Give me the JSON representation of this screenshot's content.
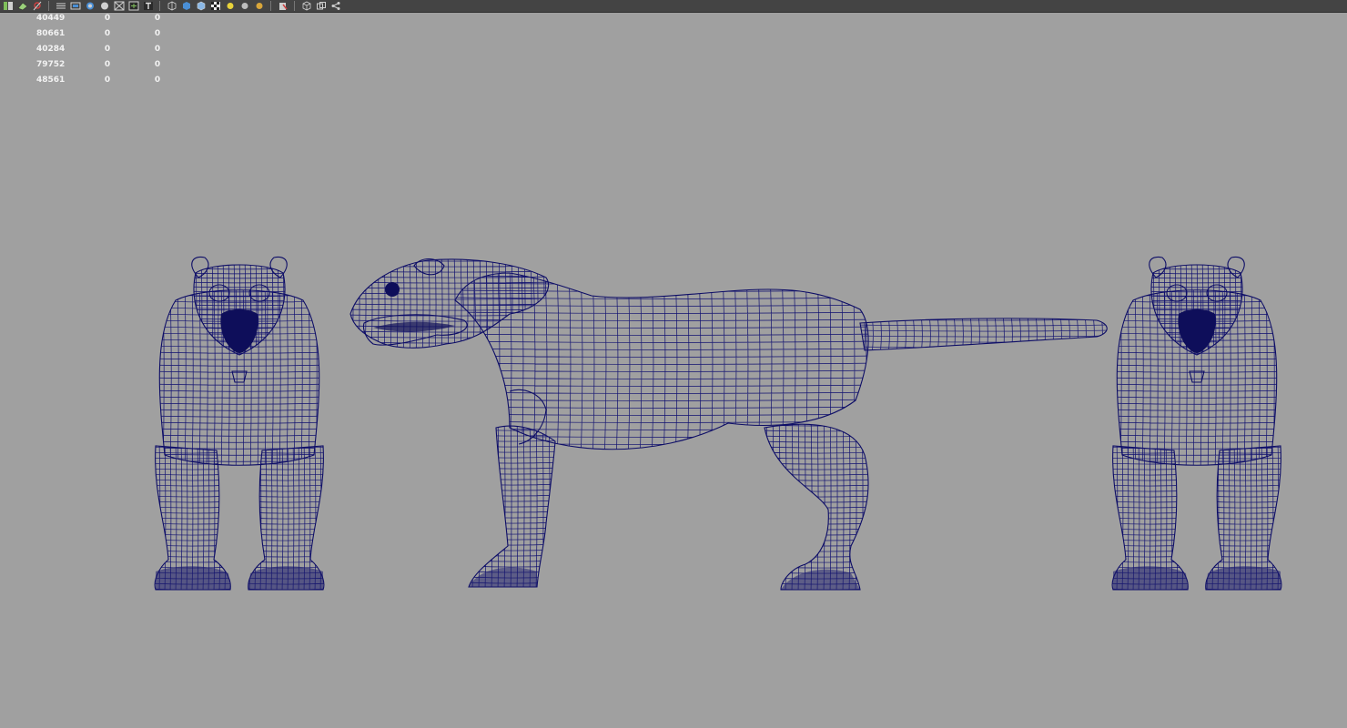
{
  "toolbar": {
    "icons": [
      "select-camera-icon",
      "camera-attributes-icon",
      "bookmarks-icon",
      "grid-icon",
      "film-gate-icon",
      "resolution-gate-icon",
      "field-chart-icon",
      "safe-action-icon",
      "safe-title-icon",
      "wireframe-icon",
      "smooth-shade-icon",
      "xray-icon",
      "texture-icon",
      "default-light-icon",
      "shadows-icon",
      "ambient-occlusion-icon",
      "isolate-select-icon",
      "xray-joints-icon",
      "bounding-box-icon",
      "hierarchy-icon"
    ],
    "colors": {
      "bar": "#444444",
      "icon_light": "#d0d0d0",
      "accent_blue": "#4a8fd6",
      "accent_yellow": "#e8d23a",
      "accent_red": "#d04040"
    }
  },
  "hud": {
    "rows": [
      {
        "a": "40449",
        "b": "0",
        "c": "0"
      },
      {
        "a": "80661",
        "b": "0",
        "c": "0"
      },
      {
        "a": "40284",
        "b": "0",
        "c": "0"
      },
      {
        "a": "79752",
        "b": "0",
        "c": "0"
      },
      {
        "a": "48561",
        "b": "0",
        "c": "0"
      }
    ]
  },
  "viewport": {
    "background": "#a0a0a0",
    "wire_color": "#101070",
    "objects": [
      "front-view-model",
      "side-view-model",
      "back-view-model"
    ]
  }
}
